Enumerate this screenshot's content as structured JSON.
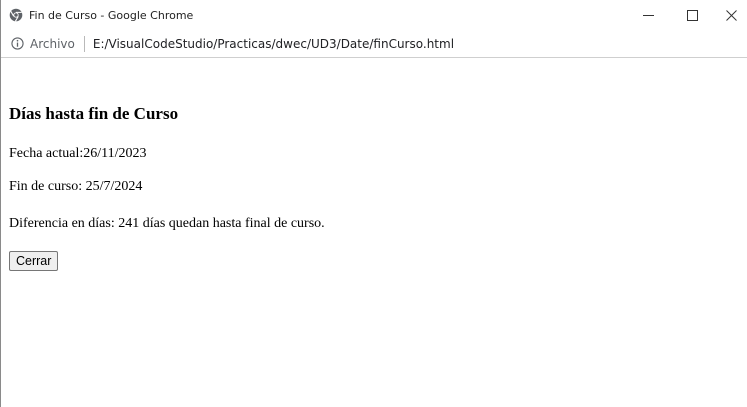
{
  "window": {
    "title": "Fin de Curso - Google Chrome",
    "controls": {
      "minimize_icon": "minimize-icon",
      "maximize_icon": "maximize-icon",
      "close_icon": "close-icon"
    }
  },
  "addressbar": {
    "security_icon": "info-icon",
    "security_label": "Archivo",
    "url": "E:/VisualCodeStudio/Practicas/dwec/UD3/Date/finCurso.html"
  },
  "page": {
    "heading": "Días hasta fin de Curso",
    "current_date_line": "Fecha actual:26/11/2023",
    "end_date_line": "Fin de curso: 25/7/2024",
    "difference_line": "Diferencia en días: 241 días quedan hasta final de curso.",
    "close_button_label": "Cerrar"
  }
}
